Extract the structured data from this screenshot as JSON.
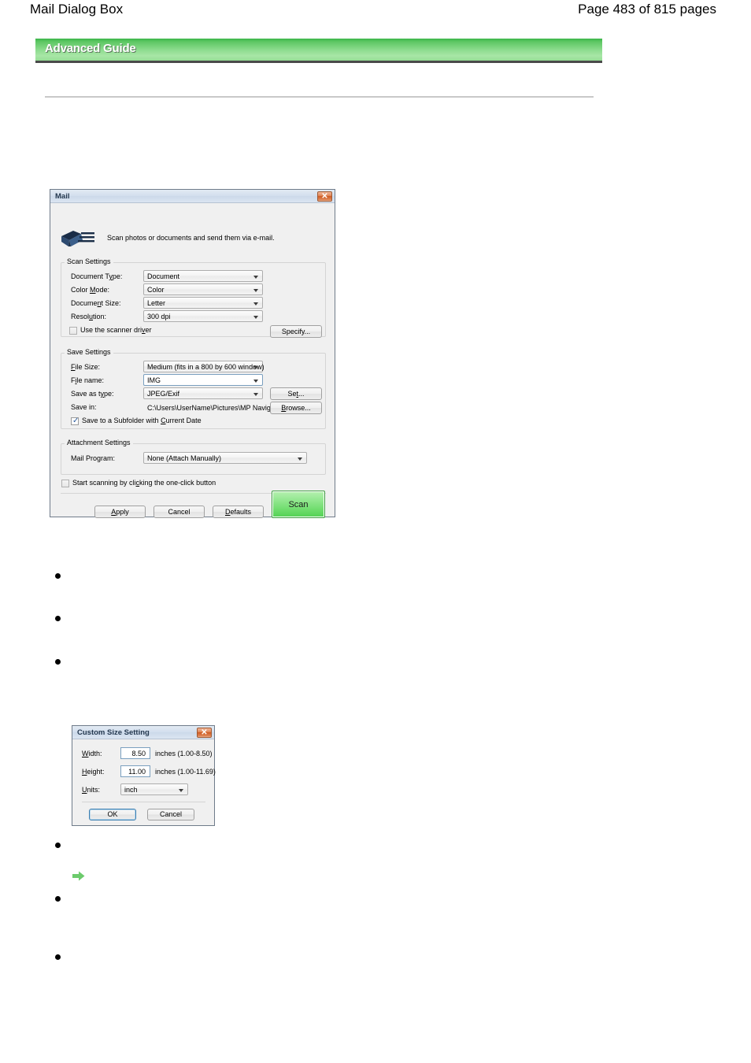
{
  "page": {
    "doc_title": "Mail Dialog Box",
    "page_number": "Page 483 of 815 pages",
    "banner_label": "Advanced Guide"
  },
  "mail_dialog": {
    "title": "Mail",
    "close_glyph": "✕",
    "icon_name": "mail-envelope-icon",
    "banner_text": "Scan photos or documents and send them via e-mail.",
    "scan_settings": {
      "group_label": "Scan Settings",
      "fields": [
        {
          "label": "Document Type:",
          "value": "Document",
          "control": "combo"
        },
        {
          "label": "Color Mode:",
          "value": "Color",
          "control": "combo"
        },
        {
          "label": "Document Size:",
          "value": "Letter",
          "control": "combo"
        },
        {
          "label": "Resolution:",
          "value": "300 dpi",
          "control": "combo"
        }
      ],
      "scanner_driver_checkbox": {
        "label": "Use the scanner driver",
        "checked": false
      },
      "specify_button": "Specify..."
    },
    "save_settings": {
      "group_label": "Save Settings",
      "file_size": {
        "label": "File Size:",
        "value": "Medium (fits in a 800 by 600 window)"
      },
      "file_name": {
        "label": "File name:",
        "value": "IMG"
      },
      "save_as_type": {
        "label": "Save as  type:",
        "value": "JPEG/Exif"
      },
      "set_button": "Set...",
      "save_in": {
        "label": "Save in:",
        "value": "C:\\Users\\UserName\\Pictures\\MP Navigat"
      },
      "browse_button": "Browse...",
      "subfolder_checkbox": {
        "label": "Save to a Subfolder with Current Date",
        "checked": true
      }
    },
    "attachment_settings": {
      "group_label": "Attachment Settings",
      "mail_program": {
        "label": "Mail Program:",
        "value": "None (Attach Manually)"
      }
    },
    "one_click_checkbox": {
      "label": "Start scanning by clicking the one-click button",
      "checked": false
    },
    "buttons": {
      "apply": "Apply",
      "cancel": "Cancel",
      "defaults": "Defaults",
      "scan": "Scan"
    },
    "accent_green": "#6ddc6b"
  },
  "custom_size_dialog": {
    "title": "Custom Size Setting",
    "close_glyph": "✕",
    "width": {
      "label": "Width:",
      "value": "8.50",
      "range": "inches (1.00-8.50)"
    },
    "height": {
      "label": "Height:",
      "value": "11.00",
      "range": "inches (1.00-11.69)"
    },
    "units": {
      "label": "Units:",
      "value": "inch"
    },
    "ok_button": "OK",
    "cancel_button": "Cancel"
  },
  "bullets": [
    {
      "text": ""
    },
    {
      "text": ""
    },
    {
      "text": ""
    },
    {
      "text": ""
    },
    {
      "text": ""
    },
    {
      "text": ""
    }
  ],
  "link_marker": {
    "icon_name": "green-arrow-icon",
    "color": "#6ccb6c"
  }
}
